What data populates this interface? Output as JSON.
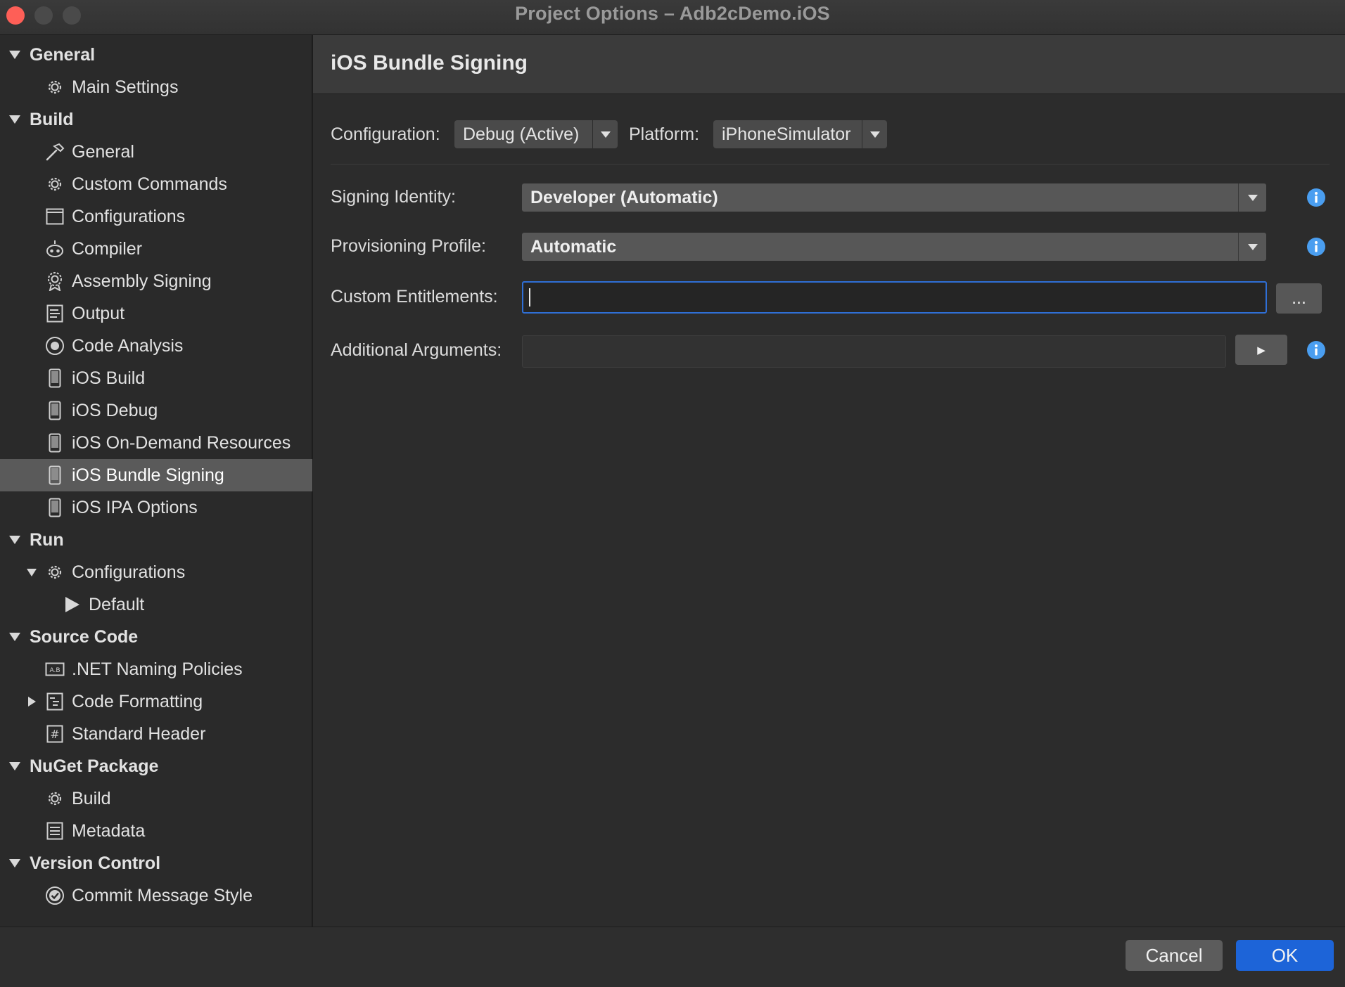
{
  "window": {
    "title": "Project Options – Adb2cDemo.iOS"
  },
  "sidebar": {
    "items": [
      {
        "label": "General",
        "type": "header",
        "icon": "triangle-down-icon"
      },
      {
        "label": "Main Settings",
        "type": "item",
        "icon": "gear-icon"
      },
      {
        "label": "Build",
        "type": "header",
        "icon": "triangle-down-icon"
      },
      {
        "label": "General",
        "type": "item",
        "icon": "hammer-icon"
      },
      {
        "label": "Custom Commands",
        "type": "item",
        "icon": "gear-icon"
      },
      {
        "label": "Configurations",
        "type": "item",
        "icon": "window-icon"
      },
      {
        "label": "Compiler",
        "type": "item",
        "icon": "robot-icon"
      },
      {
        "label": "Assembly Signing",
        "type": "item",
        "icon": "badge-icon"
      },
      {
        "label": "Output",
        "type": "item",
        "icon": "document-icon"
      },
      {
        "label": "Code Analysis",
        "type": "item",
        "icon": "target-icon"
      },
      {
        "label": "iOS Build",
        "type": "item",
        "icon": "phone-icon"
      },
      {
        "label": "iOS Debug",
        "type": "item",
        "icon": "phone-icon"
      },
      {
        "label": "iOS On-Demand Resources",
        "type": "item",
        "icon": "phone-icon"
      },
      {
        "label": "iOS Bundle Signing",
        "type": "item",
        "icon": "phone-icon",
        "selected": true
      },
      {
        "label": "iOS IPA Options",
        "type": "item",
        "icon": "phone-icon"
      },
      {
        "label": "Run",
        "type": "header",
        "icon": "triangle-down-icon"
      },
      {
        "label": "Configurations",
        "type": "item",
        "icon": "gear-icon",
        "expanded": true
      },
      {
        "label": "Default",
        "type": "subitem",
        "icon": "play-icon"
      },
      {
        "label": "Source Code",
        "type": "header",
        "icon": "triangle-down-icon"
      },
      {
        "label": ".NET Naming Policies",
        "type": "item",
        "icon": "naming-icon"
      },
      {
        "label": "Code Formatting",
        "type": "item",
        "icon": "format-icon",
        "collapsed": true
      },
      {
        "label": "Standard Header",
        "type": "item",
        "icon": "hash-icon"
      },
      {
        "label": "NuGet Package",
        "type": "header",
        "icon": "triangle-down-icon"
      },
      {
        "label": "Build",
        "type": "item",
        "icon": "gear-icon"
      },
      {
        "label": "Metadata",
        "type": "item",
        "icon": "list-icon"
      },
      {
        "label": "Version Control",
        "type": "header",
        "icon": "triangle-down-icon"
      },
      {
        "label": "Commit Message Style",
        "type": "item",
        "icon": "check-circle-icon"
      }
    ]
  },
  "main": {
    "title": "iOS Bundle Signing",
    "configuration_label": "Configuration:",
    "configuration_value": "Debug (Active)",
    "platform_label": "Platform:",
    "platform_value": "iPhoneSimulator",
    "signing_identity_label": "Signing Identity:",
    "signing_identity_value": "Developer (Automatic)",
    "provisioning_profile_label": "Provisioning Profile:",
    "provisioning_profile_value": "Automatic",
    "custom_entitlements_label": "Custom Entitlements:",
    "custom_entitlements_value": "",
    "browse_label": "...",
    "additional_arguments_label": "Additional Arguments:",
    "additional_arguments_value": "",
    "run_arg_label": "▶"
  },
  "footer": {
    "cancel_label": "Cancel",
    "ok_label": "OK"
  },
  "colors": {
    "accent": "#1d64d8",
    "info": "#4a9ef0",
    "close": "#fe5f57"
  }
}
